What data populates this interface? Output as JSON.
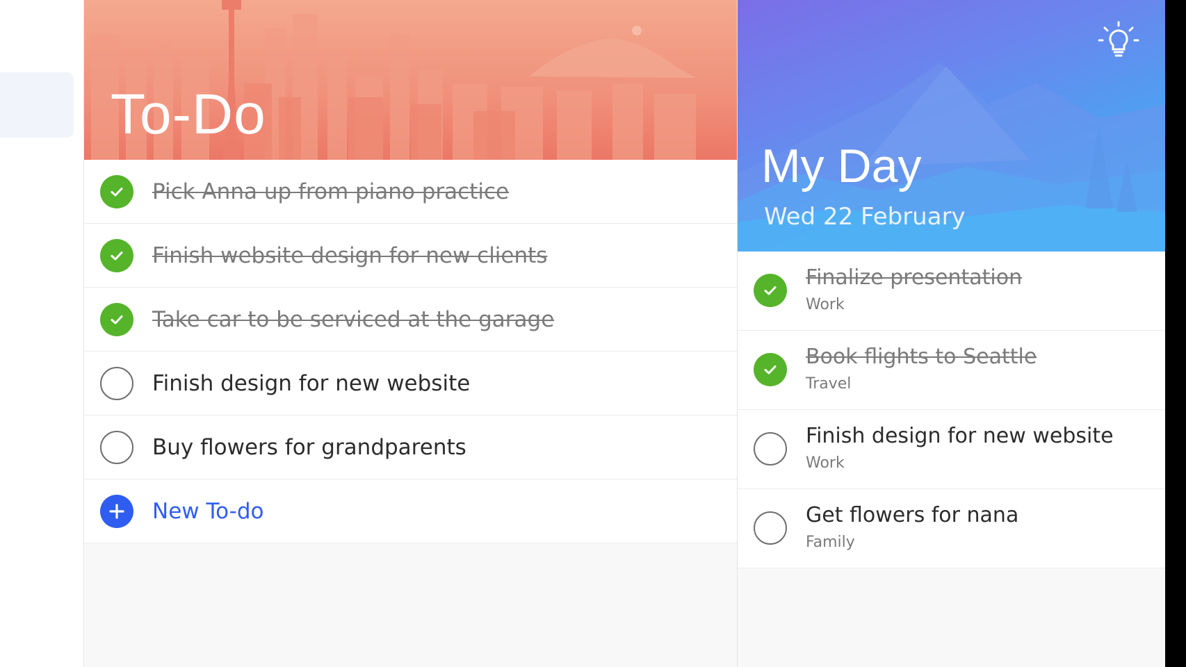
{
  "todo": {
    "title": "To-Do",
    "items": [
      {
        "label": "Pick Anna up from piano practice",
        "done": true
      },
      {
        "label": "Finish website design for new clients",
        "done": true
      },
      {
        "label": "Take car to be serviced at the garage",
        "done": true
      },
      {
        "label": "Finish design for new website",
        "done": false
      },
      {
        "label": "Buy flowers for grandparents",
        "done": false
      }
    ],
    "new_label": "New To-do",
    "new_icon": "plus-icon"
  },
  "myday": {
    "title": "My Day",
    "date": "Wed 22 February",
    "suggestions_icon": "lightbulb-icon",
    "items": [
      {
        "title": "Finalize presentation",
        "list": "Work",
        "done": true
      },
      {
        "title": "Book flights to Seattle",
        "list": "Travel",
        "done": true
      },
      {
        "title": "Finish design for new website",
        "list": "Work",
        "done": false
      },
      {
        "title": "Get flowers for nana",
        "list": "Family",
        "done": false
      }
    ]
  },
  "colors": {
    "done_green": "#56b42a",
    "accent_blue": "#2f5df0",
    "todo_header": "#f0907b",
    "myday_header": "#4aa4f2"
  }
}
